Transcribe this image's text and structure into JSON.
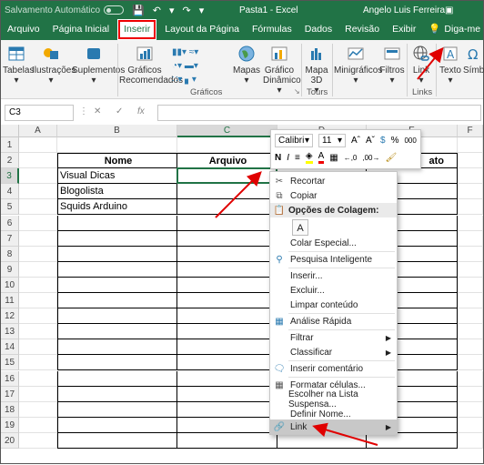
{
  "titlebar": {
    "autosave_label": "Salvamento Automático",
    "document": "Pasta1  -  Excel",
    "user": "Angelo Luis Ferreira"
  },
  "tabs": [
    "Arquivo",
    "Página Inicial",
    "Inserir",
    "Layout da Página",
    "Fórmulas",
    "Dados",
    "Revisão",
    "Exibir"
  ],
  "tell_me": "Diga-me",
  "ribbon": {
    "buttons": {
      "tabelas": "Tabelas",
      "ilustracoes": "Ilustrações",
      "suplementos": "Suplementos",
      "graficos_rec_1": "Gráficos",
      "graficos_rec_2": "Recomendados",
      "mapas": "Mapas",
      "grafico_din_1": "Gráfico",
      "grafico_din_2": "Dinâmico",
      "mapa3d_1": "Mapa",
      "mapa3d_2": "3D",
      "minigraficos": "Minigráficos",
      "filtros": "Filtros",
      "link": "Link",
      "texto": "Texto",
      "simbolos": "Símbo"
    },
    "groups": {
      "graficos": "Gráficos",
      "tours": "Tours",
      "links": "Links"
    }
  },
  "formula_bar": {
    "name_box": "C3",
    "fx": "fx",
    "value": ""
  },
  "columns": [
    "A",
    "B",
    "C",
    "D",
    "E",
    "F"
  ],
  "rows": [
    "1",
    "2",
    "3",
    "4",
    "5",
    "6",
    "7",
    "8",
    "9",
    "10",
    "11",
    "12",
    "13",
    "14",
    "15",
    "16",
    "17",
    "18",
    "19",
    "20"
  ],
  "table": {
    "header_nome": "Nome",
    "header_arquivo": "Arquivo",
    "header_partial": "ato",
    "names": [
      "Visual Dicas",
      "Blogolista",
      "Squids Arduino"
    ]
  },
  "minibar": {
    "font": "Calibri",
    "size": "11",
    "percent": "%",
    "thousands": "000"
  },
  "context_menu": {
    "recortar": "Recortar",
    "copiar": "Copiar",
    "opcoes_colagem": "Opções de Colagem:",
    "colar_especial": "Colar Especial...",
    "pesquisa": "Pesquisa Inteligente",
    "inserir": "Inserir...",
    "excluir": "Excluir...",
    "limpar": "Limpar conteúdo",
    "analise": "Análise Rápida",
    "filtrar": "Filtrar",
    "classificar": "Classificar",
    "inserir_comentario": "Inserir comentário",
    "formatar": "Formatar células...",
    "escolher": "Escolher na Lista Suspensa...",
    "definir_nome": "Definir Nome...",
    "link": "Link"
  },
  "colors": {
    "excel_green": "#217346",
    "highlight_red": "#e00000"
  }
}
